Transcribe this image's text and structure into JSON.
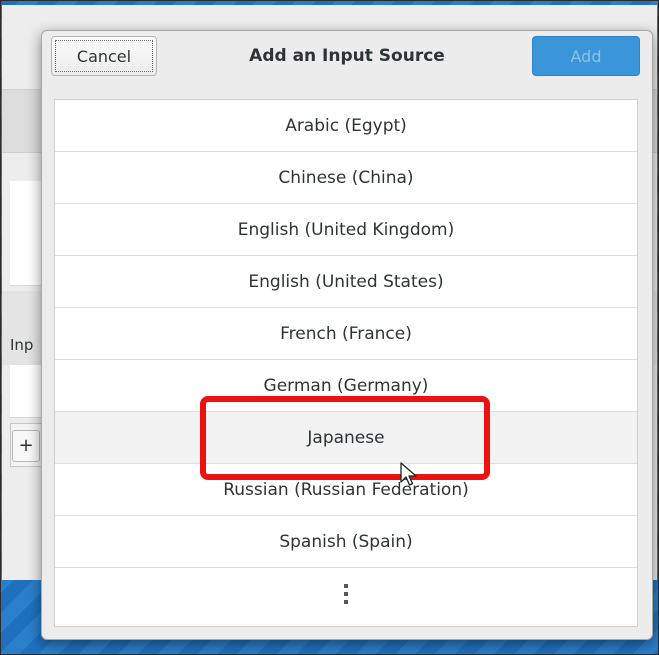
{
  "dialog": {
    "title": "Add an Input Source",
    "cancel_label": "Cancel",
    "add_label": "Add"
  },
  "background": {
    "section_label": "Inp",
    "plus_label": "+"
  },
  "list": {
    "items": [
      "Arabic (Egypt)",
      "Chinese (China)",
      "English (United Kingdom)",
      "English (United States)",
      "French (France)",
      "German (Germany)",
      "Japanese",
      "Russian (Russian Federation)",
      "Spanish (Spain)"
    ],
    "more_icon": "vertical-ellipsis-icon"
  },
  "colors": {
    "accent": "#3a96d8",
    "highlight": "#ee1111"
  }
}
